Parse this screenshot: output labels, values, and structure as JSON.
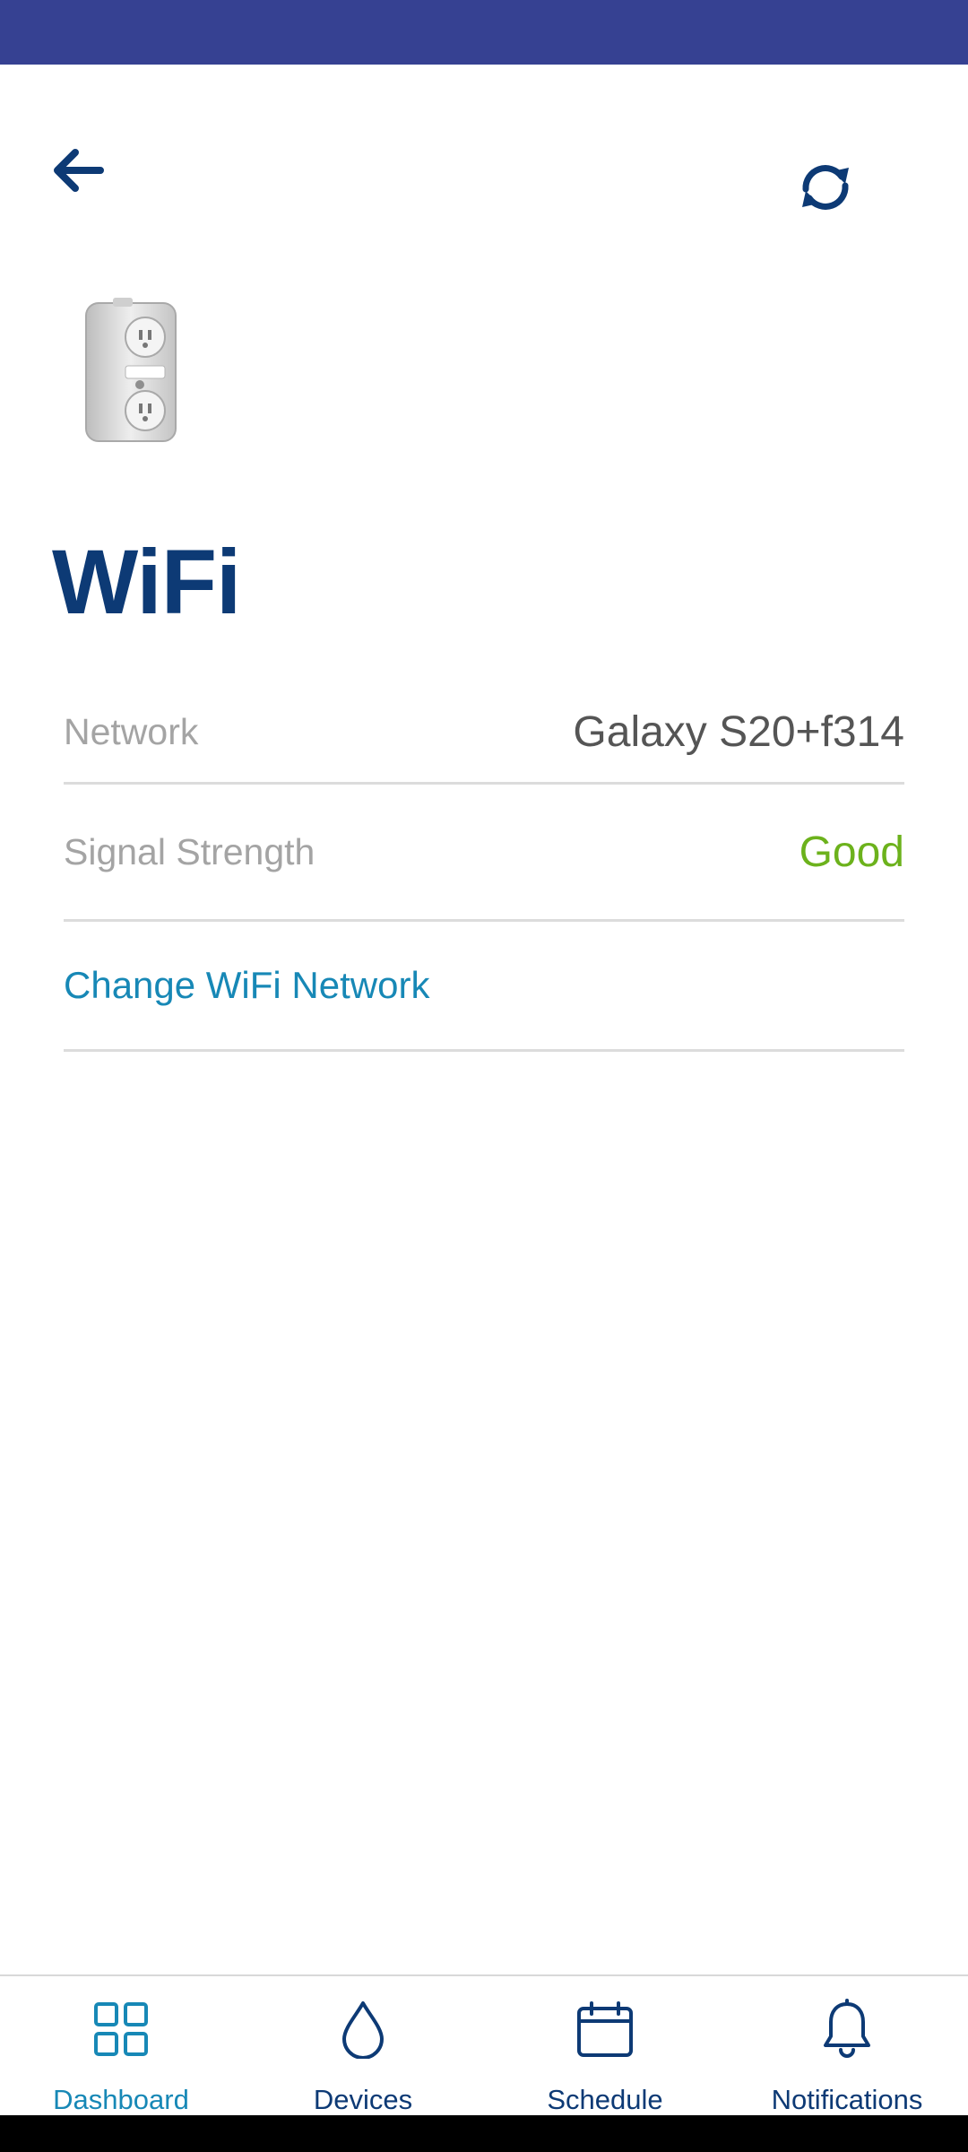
{
  "header": {
    "back_icon": "back-arrow-icon",
    "refresh_icon": "refresh-icon"
  },
  "device": {
    "image": "smart-plug-outlet-image"
  },
  "page": {
    "title": "WiFi"
  },
  "wifi": {
    "network_label": "Network",
    "network_value": "Galaxy S20+f314",
    "signal_label": "Signal Strength",
    "signal_value": "Good",
    "change_network_label": "Change WiFi Network"
  },
  "colors": {
    "status_bar": "#364192",
    "title": "#0d3a75",
    "link": "#1788b6",
    "signal_good": "#6cb21c"
  },
  "bottom_nav": {
    "items": [
      {
        "label": "Dashboard",
        "icon": "grid-icon",
        "active": true
      },
      {
        "label": "Devices",
        "icon": "water-drop-icon",
        "active": false
      },
      {
        "label": "Schedule",
        "icon": "calendar-icon",
        "active": false
      },
      {
        "label": "Notifications",
        "icon": "bell-icon",
        "active": false
      }
    ]
  }
}
